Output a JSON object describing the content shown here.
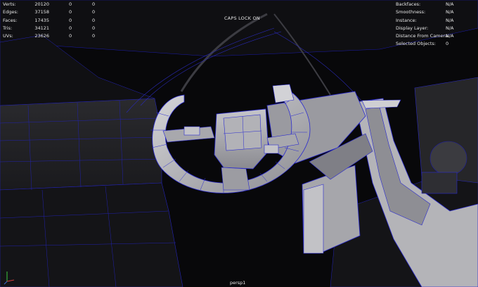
{
  "poly_count": {
    "rows": [
      {
        "label": "Verts:",
        "values": [
          "20120",
          "0",
          "0"
        ]
      },
      {
        "label": "Edges:",
        "values": [
          "37158",
          "0",
          "0"
        ]
      },
      {
        "label": "Faces:",
        "values": [
          "17435",
          "0",
          "0"
        ]
      },
      {
        "label": "Tris:",
        "values": [
          "34121",
          "0",
          "0"
        ]
      },
      {
        "label": "UVs:",
        "values": [
          "23626",
          "0",
          "0"
        ]
      }
    ]
  },
  "object_details": {
    "rows": [
      {
        "label": "Backfaces:",
        "value": "N/A"
      },
      {
        "label": "Smoothness:",
        "value": "N/A"
      },
      {
        "label": "Instance:",
        "value": "N/A"
      },
      {
        "label": "Display Layer:",
        "value": "N/A"
      },
      {
        "label": "Distance From Camera:",
        "value": "N/A"
      },
      {
        "label": "Selected Objects:",
        "value": "0"
      }
    ]
  },
  "caps_lock_message": "CAPS LOCK ON",
  "camera_name": "persp1",
  "colors": {
    "viewport_bg": "#08080a",
    "hud_text": "#e6e6e6",
    "wireframe": "#2b2bd0",
    "mesh_light": "#b9b9bd",
    "mesh_dark": "#3a3a3e",
    "axis_x": "#d23c3c",
    "axis_y": "#3cc83c",
    "axis_z": "#3c6ed2"
  }
}
